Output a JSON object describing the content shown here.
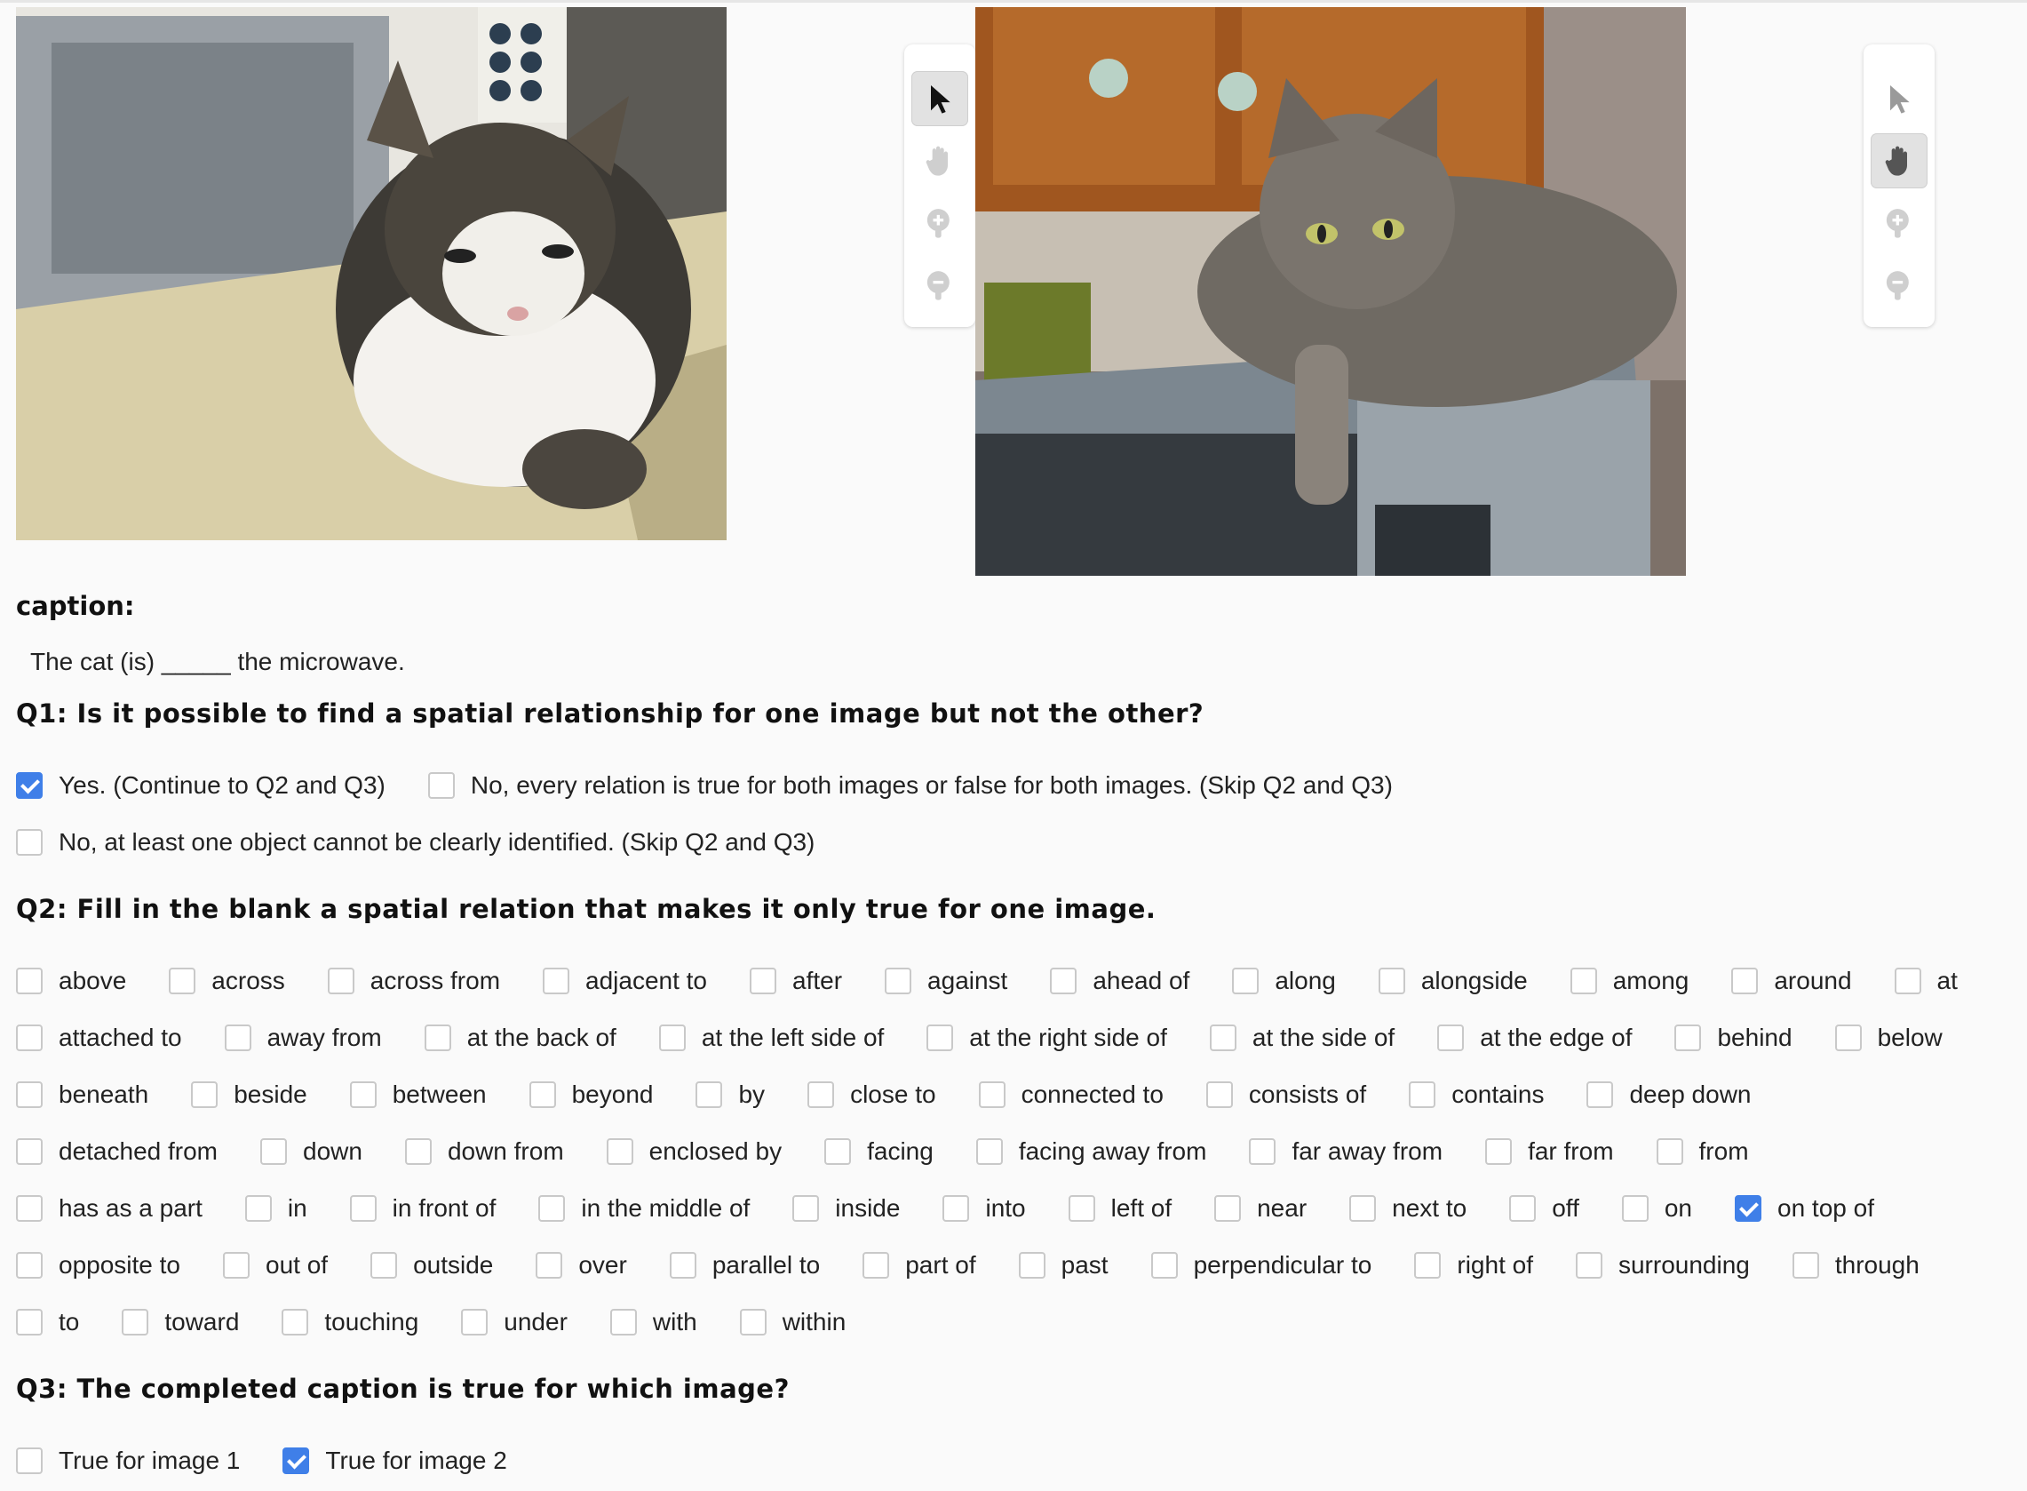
{
  "images": [
    {
      "alt": "image 1"
    },
    {
      "alt": "image 2"
    }
  ],
  "toolbars": [
    {
      "tools": [
        "pointer-icon",
        "hand-icon",
        "zoom-in-icon",
        "zoom-out-icon"
      ],
      "active": "pointer-icon"
    },
    {
      "tools": [
        "pointer-icon",
        "hand-icon",
        "zoom-in-icon",
        "zoom-out-icon"
      ],
      "active": "hand-icon"
    }
  ],
  "caption": {
    "label": "caption:",
    "text": "The cat (is) _____ the microwave."
  },
  "q1": {
    "title": "Q1: Is it possible to find a spatial relationship for one image but not the other?",
    "options": [
      {
        "label": "Yes. (Continue to Q2 and Q3)",
        "checked": true
      },
      {
        "label": "No, every relation is true for both images or false for both images. (Skip Q2 and Q3)",
        "checked": false
      },
      {
        "label": "No, at least one object cannot be clearly identified. (Skip Q2 and Q3)",
        "checked": false
      }
    ]
  },
  "q2": {
    "title": "Q2: Fill in the blank a spatial relation that makes it only true for one image.",
    "rows": [
      [
        "above",
        "across",
        "across from",
        "adjacent to",
        "after",
        "against",
        "ahead of",
        "along",
        "alongside",
        "among",
        "around",
        "at"
      ],
      [
        "attached to",
        "away from",
        "at the back of",
        "at the left side of",
        "at the right side of",
        "at the side of",
        "at the edge of",
        "behind",
        "below"
      ],
      [
        "beneath",
        "beside",
        "between",
        "beyond",
        "by",
        "close to",
        "connected to",
        "consists of",
        "contains",
        "deep down"
      ],
      [
        "detached from",
        "down",
        "down from",
        "enclosed by",
        "facing",
        "facing away from",
        "far away from",
        "far from",
        "from"
      ],
      [
        "has as a part",
        "in",
        "in front of",
        "in the middle of",
        "inside",
        "into",
        "left of",
        "near",
        "next to",
        "off",
        "on",
        "on top of"
      ],
      [
        "opposite to",
        "out of",
        "outside",
        "over",
        "parallel to",
        "part of",
        "past",
        "perpendicular to",
        "right of",
        "surrounding",
        "through"
      ],
      [
        "to",
        "toward",
        "touching",
        "under",
        "with",
        "within"
      ]
    ],
    "checked": [
      "on top of"
    ]
  },
  "q3": {
    "title": "Q3: The completed caption is true for which image?",
    "options": [
      {
        "label": "True for image 1",
        "checked": false
      },
      {
        "label": "True for image 2",
        "checked": true
      }
    ]
  },
  "colors": {
    "accent": "#3f7fe8",
    "checkbox_border": "#c9c9c9",
    "background": "#fafafa"
  }
}
